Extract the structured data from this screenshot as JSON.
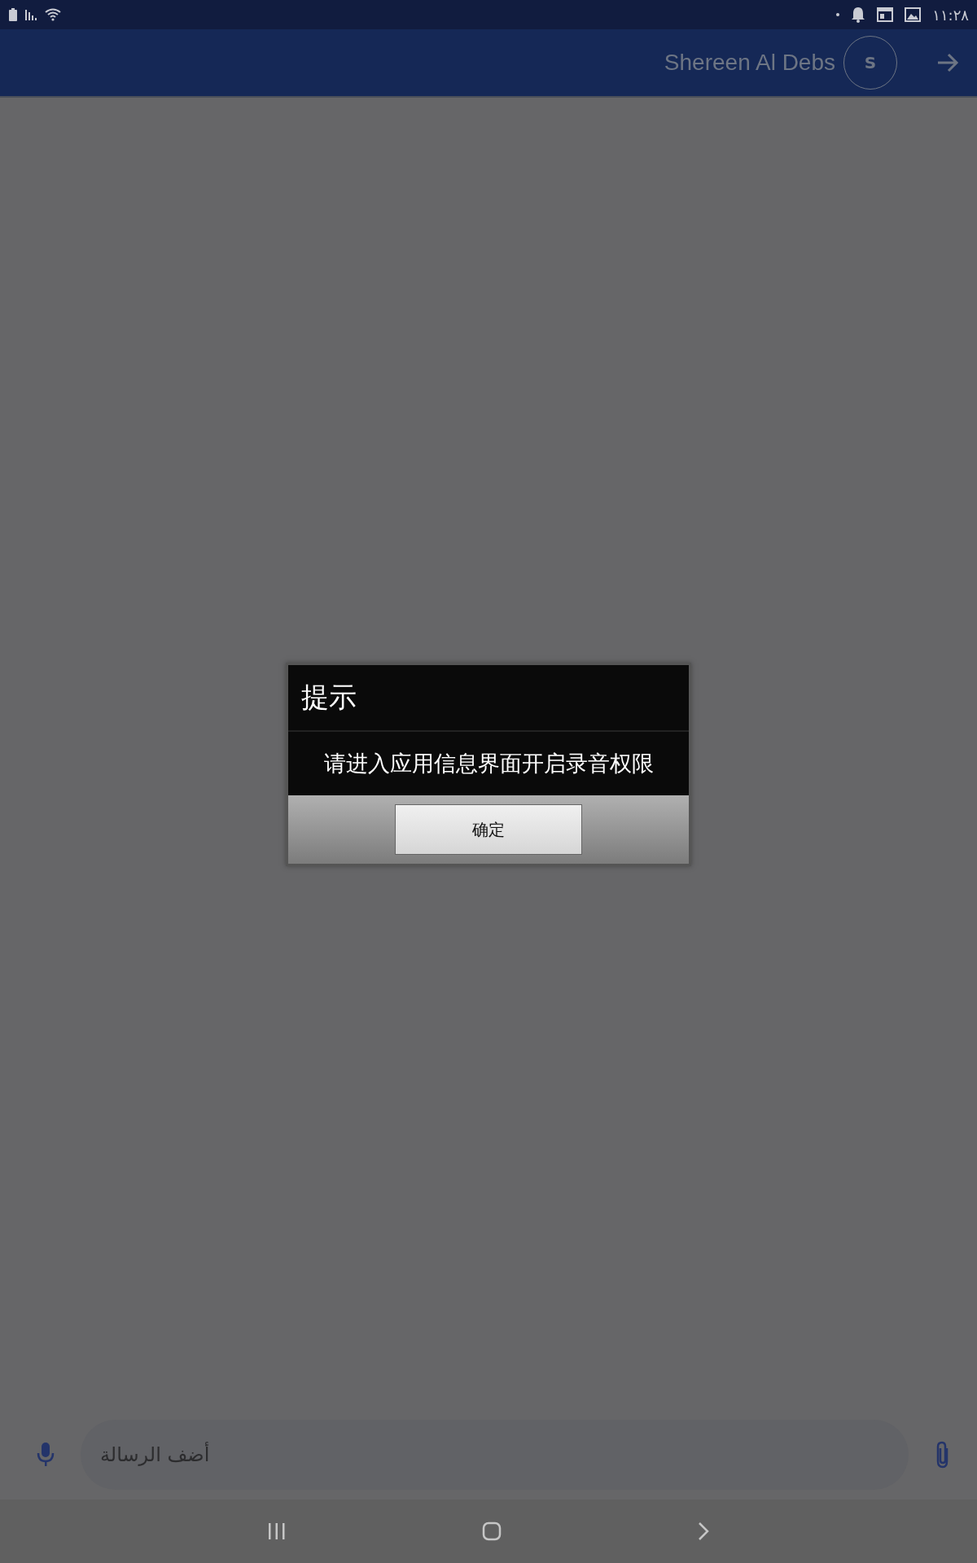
{
  "status_bar": {
    "time": "١١:٢٨"
  },
  "header": {
    "name": "Shereen Al Debs",
    "avatar_letter": "S"
  },
  "dialog": {
    "title": "提示",
    "message": "请进入应用信息界面开启录音权限",
    "button": "确定"
  },
  "composer": {
    "placeholder": "أضف الرسالة"
  }
}
